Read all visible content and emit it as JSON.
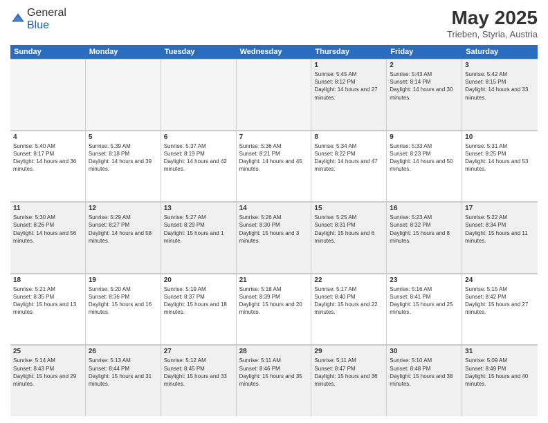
{
  "header": {
    "logo_line1": "General",
    "logo_line2": "Blue",
    "title": "May 2025",
    "subtitle": "Trieben, Styria, Austria"
  },
  "weekdays": [
    "Sunday",
    "Monday",
    "Tuesday",
    "Wednesday",
    "Thursday",
    "Friday",
    "Saturday"
  ],
  "rows": [
    [
      {
        "day": "",
        "empty": true
      },
      {
        "day": "",
        "empty": true
      },
      {
        "day": "",
        "empty": true
      },
      {
        "day": "",
        "empty": true
      },
      {
        "day": "1",
        "sunrise": "5:45 AM",
        "sunset": "8:12 PM",
        "daylight": "14 hours and 27 minutes."
      },
      {
        "day": "2",
        "sunrise": "5:43 AM",
        "sunset": "8:14 PM",
        "daylight": "14 hours and 30 minutes."
      },
      {
        "day": "3",
        "sunrise": "5:42 AM",
        "sunset": "8:15 PM",
        "daylight": "14 hours and 33 minutes."
      }
    ],
    [
      {
        "day": "4",
        "sunrise": "5:40 AM",
        "sunset": "8:17 PM",
        "daylight": "14 hours and 36 minutes."
      },
      {
        "day": "5",
        "sunrise": "5:39 AM",
        "sunset": "8:18 PM",
        "daylight": "14 hours and 39 minutes."
      },
      {
        "day": "6",
        "sunrise": "5:37 AM",
        "sunset": "8:19 PM",
        "daylight": "14 hours and 42 minutes."
      },
      {
        "day": "7",
        "sunrise": "5:36 AM",
        "sunset": "8:21 PM",
        "daylight": "14 hours and 45 minutes."
      },
      {
        "day": "8",
        "sunrise": "5:34 AM",
        "sunset": "8:22 PM",
        "daylight": "14 hours and 47 minutes."
      },
      {
        "day": "9",
        "sunrise": "5:33 AM",
        "sunset": "8:23 PM",
        "daylight": "14 hours and 50 minutes."
      },
      {
        "day": "10",
        "sunrise": "5:31 AM",
        "sunset": "8:25 PM",
        "daylight": "14 hours and 53 minutes."
      }
    ],
    [
      {
        "day": "11",
        "sunrise": "5:30 AM",
        "sunset": "8:26 PM",
        "daylight": "14 hours and 56 minutes."
      },
      {
        "day": "12",
        "sunrise": "5:29 AM",
        "sunset": "8:27 PM",
        "daylight": "14 hours and 58 minutes."
      },
      {
        "day": "13",
        "sunrise": "5:27 AM",
        "sunset": "8:29 PM",
        "daylight": "15 hours and 1 minute."
      },
      {
        "day": "14",
        "sunrise": "5:26 AM",
        "sunset": "8:30 PM",
        "daylight": "15 hours and 3 minutes."
      },
      {
        "day": "15",
        "sunrise": "5:25 AM",
        "sunset": "8:31 PM",
        "daylight": "15 hours and 6 minutes."
      },
      {
        "day": "16",
        "sunrise": "5:23 AM",
        "sunset": "8:32 PM",
        "daylight": "15 hours and 8 minutes."
      },
      {
        "day": "17",
        "sunrise": "5:22 AM",
        "sunset": "8:34 PM",
        "daylight": "15 hours and 11 minutes."
      }
    ],
    [
      {
        "day": "18",
        "sunrise": "5:21 AM",
        "sunset": "8:35 PM",
        "daylight": "15 hours and 13 minutes."
      },
      {
        "day": "19",
        "sunrise": "5:20 AM",
        "sunset": "8:36 PM",
        "daylight": "15 hours and 16 minutes."
      },
      {
        "day": "20",
        "sunrise": "5:19 AM",
        "sunset": "8:37 PM",
        "daylight": "15 hours and 18 minutes."
      },
      {
        "day": "21",
        "sunrise": "5:18 AM",
        "sunset": "8:39 PM",
        "daylight": "15 hours and 20 minutes."
      },
      {
        "day": "22",
        "sunrise": "5:17 AM",
        "sunset": "8:40 PM",
        "daylight": "15 hours and 22 minutes."
      },
      {
        "day": "23",
        "sunrise": "5:16 AM",
        "sunset": "8:41 PM",
        "daylight": "15 hours and 25 minutes."
      },
      {
        "day": "24",
        "sunrise": "5:15 AM",
        "sunset": "8:42 PM",
        "daylight": "15 hours and 27 minutes."
      }
    ],
    [
      {
        "day": "25",
        "sunrise": "5:14 AM",
        "sunset": "8:43 PM",
        "daylight": "15 hours and 29 minutes."
      },
      {
        "day": "26",
        "sunrise": "5:13 AM",
        "sunset": "8:44 PM",
        "daylight": "15 hours and 31 minutes."
      },
      {
        "day": "27",
        "sunrise": "5:12 AM",
        "sunset": "8:45 PM",
        "daylight": "15 hours and 33 minutes."
      },
      {
        "day": "28",
        "sunrise": "5:11 AM",
        "sunset": "8:46 PM",
        "daylight": "15 hours and 35 minutes."
      },
      {
        "day": "29",
        "sunrise": "5:11 AM",
        "sunset": "8:47 PM",
        "daylight": "15 hours and 36 minutes."
      },
      {
        "day": "30",
        "sunrise": "5:10 AM",
        "sunset": "8:48 PM",
        "daylight": "15 hours and 38 minutes."
      },
      {
        "day": "31",
        "sunrise": "5:09 AM",
        "sunset": "8:49 PM",
        "daylight": "15 hours and 40 minutes."
      }
    ]
  ]
}
